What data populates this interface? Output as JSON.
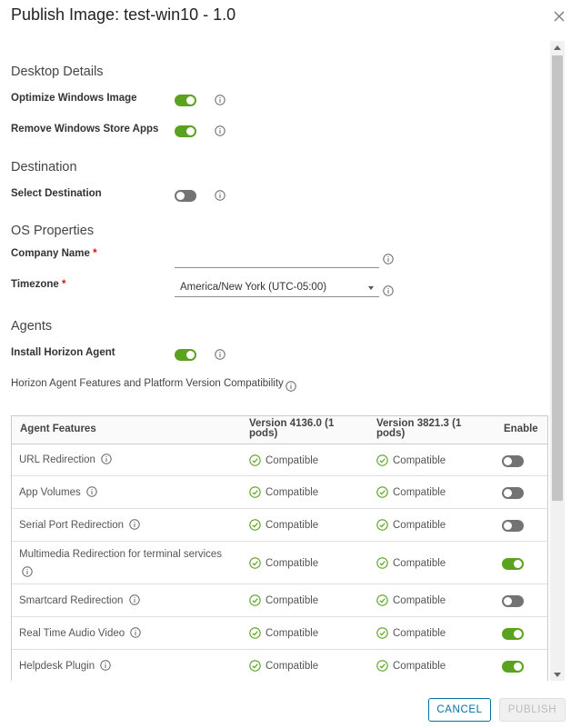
{
  "dialog": {
    "title": "Publish Image: test-win10 - 1.0",
    "cancel_label": "CANCEL",
    "publish_label": "PUBLISH"
  },
  "desktop_details": {
    "heading": "Desktop Details",
    "optimize_label": "Optimize Windows Image",
    "optimize_on": true,
    "remove_apps_label": "Remove Windows Store Apps",
    "remove_apps_on": true
  },
  "destination": {
    "heading": "Destination",
    "select_label": "Select Destination",
    "select_on": false
  },
  "os_properties": {
    "heading": "OS Properties",
    "company_label": "Company Name",
    "company_value": "",
    "timezone_label": "Timezone",
    "timezone_value": "America/New York (UTC-05:00)",
    "required_mark": "*"
  },
  "agents": {
    "heading": "Agents",
    "install_label": "Install Horizon Agent",
    "install_on": true,
    "compat_label": "Horizon Agent Features and Platform Version Compatibility"
  },
  "table": {
    "headers": {
      "feature": "Agent Features",
      "v1": "Version 4136.0 (1 pods)",
      "v2": "Version 3821.3 (1 pods)",
      "enable": "Enable"
    },
    "rows": [
      {
        "feature": "URL Redirection",
        "v1": "Compatible",
        "v2": "Compatible",
        "enabled": false
      },
      {
        "feature": "App Volumes",
        "v1": "Compatible",
        "v2": "Compatible",
        "enabled": false
      },
      {
        "feature": "Serial Port Redirection",
        "v1": "Compatible",
        "v2": "Compatible",
        "enabled": false
      },
      {
        "feature": "Multimedia Redirection for terminal services",
        "v1": "Compatible",
        "v2": "Compatible",
        "enabled": true
      },
      {
        "feature": "Smartcard Redirection",
        "v1": "Compatible",
        "v2": "Compatible",
        "enabled": false
      },
      {
        "feature": "Real Time Audio Video",
        "v1": "Compatible",
        "v2": "Compatible",
        "enabled": true
      },
      {
        "feature": "Helpdesk Plugin",
        "v1": "Compatible",
        "v2": "Compatible",
        "enabled": true
      }
    ]
  },
  "colors": {
    "toggle_on": "#5aa220",
    "toggle_off": "#737373",
    "accent": "#0072a3",
    "ok": "#5aa220"
  },
  "icons": {
    "info": "info-icon",
    "close": "close-icon",
    "compatible": "check-circle-icon"
  }
}
